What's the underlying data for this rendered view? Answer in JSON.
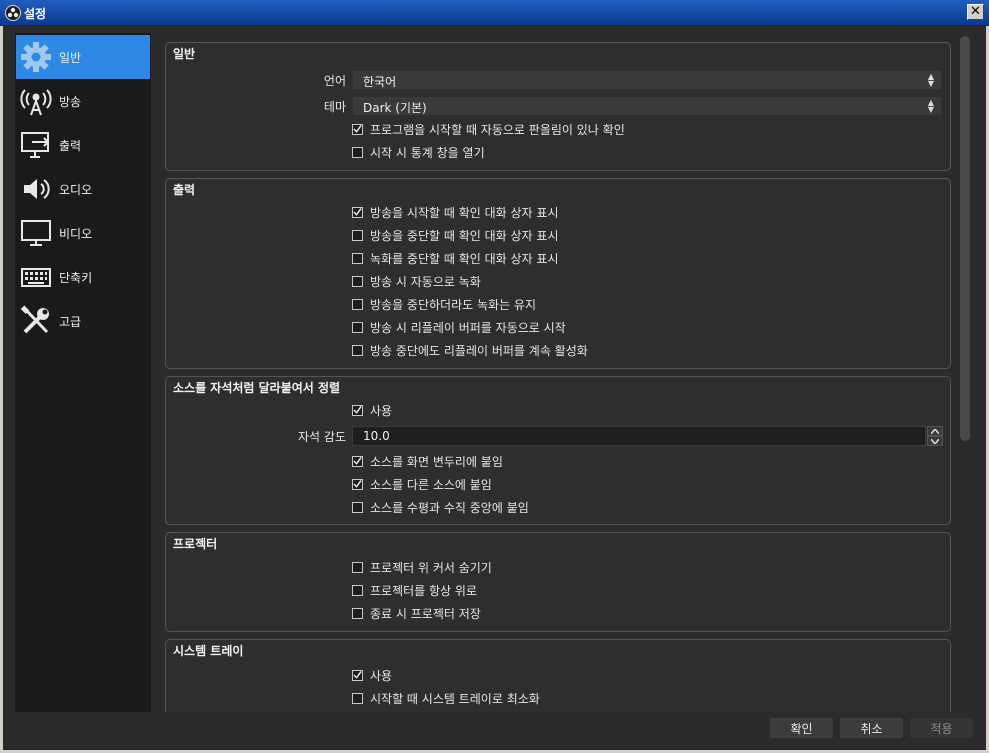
{
  "window": {
    "title": "설정",
    "close_glyph": "✕"
  },
  "sidebar": {
    "items": [
      {
        "label": "일반",
        "icon": "gear-icon",
        "active": true
      },
      {
        "label": "방송",
        "icon": "broadcast-icon",
        "active": false
      },
      {
        "label": "출력",
        "icon": "output-icon",
        "active": false
      },
      {
        "label": "오디오",
        "icon": "speaker-icon",
        "active": false
      },
      {
        "label": "비디오",
        "icon": "monitor-icon",
        "active": false
      },
      {
        "label": "단축키",
        "icon": "keyboard-icon",
        "active": false
      },
      {
        "label": "고급",
        "icon": "tools-icon",
        "active": false
      }
    ]
  },
  "general": {
    "title": "일반",
    "language_label": "언어",
    "language_value": "한국어",
    "theme_label": "테마",
    "theme_value": "Dark (기본)",
    "checks": [
      {
        "label": "프로그램을 시작할 때 자동으로 판올림이 있나 확인",
        "checked": true
      },
      {
        "label": "시작 시 통계 창을 열기",
        "checked": false
      }
    ]
  },
  "output": {
    "title": "출력",
    "checks": [
      {
        "label": "방송을 시작할 때 확인 대화 상자 표시",
        "checked": true
      },
      {
        "label": "방송을 중단할 때 확인 대화 상자 표시",
        "checked": false
      },
      {
        "label": "녹화를 중단할 때 확인 대화 상자 표시",
        "checked": false
      },
      {
        "label": "방송 시 자동으로 녹화",
        "checked": false
      },
      {
        "label": "방송을 중단하더라도 녹화는 유지",
        "checked": false
      },
      {
        "label": "방송 시 리플레이 버퍼를 자동으로 시작",
        "checked": false
      },
      {
        "label": "방송 중단에도 리플레이 버퍼를 계속 활성화",
        "checked": false
      }
    ]
  },
  "snapping": {
    "title": "소스를 자석처럼 달라붙여서 정렬",
    "enable": {
      "label": "사용",
      "checked": true
    },
    "sensitivity_label": "자석 감도",
    "sensitivity_value": "10.0",
    "checks": [
      {
        "label": "소스를 화면 변두리에 붙임",
        "checked": true
      },
      {
        "label": "소스를 다른 소스에 붙임",
        "checked": true
      },
      {
        "label": "소스를 수평과 수직 중앙에 붙임",
        "checked": false
      }
    ]
  },
  "projector": {
    "title": "프로젝터",
    "checks": [
      {
        "label": "프로젝터 위 커서 숨기기",
        "checked": false
      },
      {
        "label": "프로젝터를 항상 위로",
        "checked": false
      },
      {
        "label": "종료 시 프로젝터 저장",
        "checked": false
      }
    ]
  },
  "tray": {
    "title": "시스템 트레이",
    "checks": [
      {
        "label": "사용",
        "checked": true
      },
      {
        "label": "시작할 때 시스템 트레이로 최소화",
        "checked": false
      }
    ]
  },
  "buttons": {
    "ok": "확인",
    "cancel": "취소",
    "apply": "적용"
  }
}
